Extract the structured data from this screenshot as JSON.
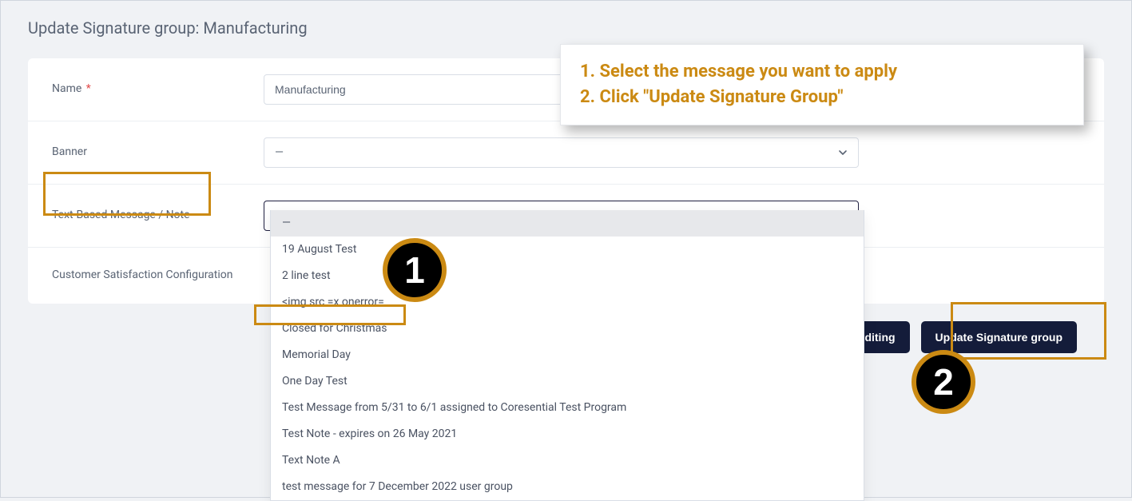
{
  "page": {
    "title": "Update Signature group: Manufacturing"
  },
  "form": {
    "name": {
      "label": "Name",
      "required_indicator": "*",
      "value": "Manufacturing"
    },
    "banner": {
      "label": "Banner",
      "value": "—"
    },
    "text_message": {
      "label": "Text-Based Message / Note",
      "selected": "—",
      "options": [
        "—",
        "19 August Test",
        "2 line test",
        "<img src =x onerror=",
        "Closed for Christmas",
        "Memorial Day",
        "One Day Test",
        "Test Message from 5/31 to 6/1 assigned to Coresential Test Program",
        "Test Note - expires on 26 May 2021",
        "Text Note A",
        "test message for 7 December 2022 user group"
      ]
    },
    "csat": {
      "label": "Customer Satisfaction Configuration"
    }
  },
  "buttons": {
    "continue": "Continue Editing",
    "update": "Update Signature group"
  },
  "annotations": {
    "step1_badge": "1",
    "step2_badge": "2",
    "instruction_line1": "1. Select the message you want to apply",
    "instruction_line2": "2. Click \"Update Signature Group\""
  },
  "colors": {
    "accent_orange": "#cb8a13",
    "button_bg": "#141c3a"
  }
}
